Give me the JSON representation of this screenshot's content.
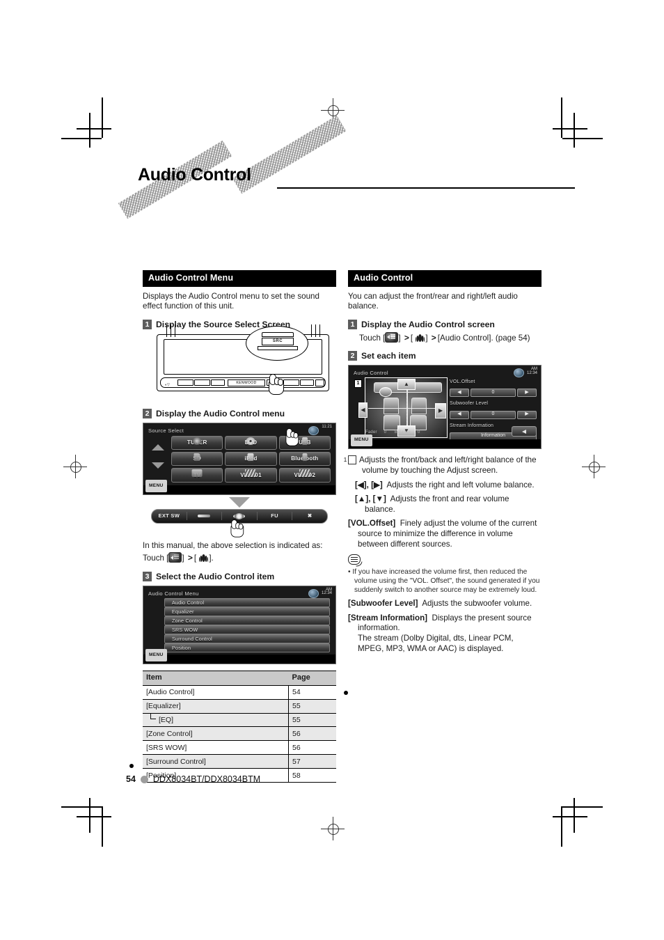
{
  "document": {
    "title": "Audio Control",
    "page_number": "54",
    "model": "DDX8034BT/DDX8034BTM"
  },
  "left_column": {
    "section_title": "Audio Control Menu",
    "intro": "Displays the Audio Control menu to set the sound effect function of this unit.",
    "step1": {
      "num": "1",
      "text": "Display the Source Select Screen"
    },
    "faceplate": {
      "button_label": "SRC",
      "brand": "KENWOOD"
    },
    "step2": {
      "num": "2",
      "text": "Display the Audio Control menu"
    },
    "source_select_screen": {
      "title": "Source Select",
      "clock": "11:21",
      "menu_button": "MENU",
      "sources": [
        "TUNER",
        "DVD",
        "USB",
        "SD",
        "iPod",
        "Bluetooth",
        "TV",
        "VIDEO1",
        "VIDEO2"
      ]
    },
    "bottom_strip": [
      "EXT SW",
      "setup-icon",
      "audio-icon",
      "FU",
      "close-icon"
    ],
    "manual_note_line1": "In this manual, the above selection is indicated as:",
    "manual_note_touch_prefix": "Touch [",
    "manual_note_touch_mid": "] ",
    "manual_note_touch_sep": "> [ ",
    "manual_note_touch_suffix": "].",
    "step3": {
      "num": "3",
      "text": "Select the Audio Control item"
    },
    "audio_control_menu_screen": {
      "title": "Audio Control Menu",
      "clock_ampm": "AM",
      "clock_time": "12:34",
      "menu_button": "MENU",
      "rows": [
        "Audio Control",
        "Equalizer",
        "Zone Control",
        "SRS WOW",
        "Surround Control",
        "Position"
      ]
    },
    "table": {
      "headers": [
        "Item",
        "Page"
      ],
      "rows": [
        {
          "item": "[Audio Control]",
          "page": "54",
          "sub": false
        },
        {
          "item": "[Equalizer]",
          "page": "55",
          "sub": false
        },
        {
          "item": "[EQ]",
          "page": "55",
          "sub": true
        },
        {
          "item": "[Zone Control]",
          "page": "56",
          "sub": false
        },
        {
          "item": "[SRS WOW]",
          "page": "56",
          "sub": false
        },
        {
          "item": "[Surround Control]",
          "page": "57",
          "sub": false
        },
        {
          "item": "[Position]",
          "page": "58",
          "sub": false
        }
      ]
    }
  },
  "right_column": {
    "section_title": "Audio Control",
    "intro": "You can adjust the front/rear and right/left audio balance.",
    "step1": {
      "num": "1",
      "text": "Display the Audio Control screen"
    },
    "touch_prefix": "Touch [",
    "touch_sep1": "] ",
    "touch_sep2": "> [ ",
    "touch_sep3": "] ",
    "touch_tail": "> [Audio Control]. (page 54)",
    "step2": {
      "num": "2",
      "text": "Set each item"
    },
    "audio_control_screen": {
      "title": "Audio Control",
      "clock_ampm": "AM",
      "clock_time": "12:34",
      "menu_button": "MENU",
      "marker": "1",
      "vol_offset_label": "VOL.Offset",
      "vol_offset_value": "0",
      "subwoofer_label": "Subwoofer Level",
      "subwoofer_value": "0",
      "stream_label": "Stream Information",
      "stream_button": "Information",
      "fader_label": "Fader",
      "fader_value": "0",
      "balance_label": "Balance",
      "balance_value": "0"
    },
    "desc_marker": "1",
    "desc_1": "Adjusts the front/back and left/right balance of the volume by touching the Adjust screen.",
    "desc_lr_key": "[◀], [▶]",
    "desc_lr_text": "Adjusts the right and left volume balance.",
    "desc_ud_key": "[▲], [▼]",
    "desc_ud_text": "Adjusts the front and rear volume balance.",
    "vol_offset_key": "[VOL.Offset]",
    "vol_offset_text": "Finely adjust the volume of the current source to minimize the difference in volume between different sources.",
    "note_text": "If you have increased the volume first, then reduced the volume using the \"VOL. Offset\", the sound generated if you suddenly switch to another source may be extremely loud.",
    "subwoofer_key": "[Subwoofer Level]",
    "subwoofer_text": "Adjusts the subwoofer volume.",
    "stream_key": "[Stream Information]",
    "stream_text": "Displays the present source information.",
    "stream_text2": "The stream (Dolby Digital, dts, Linear PCM, MPEG, MP3, WMA or AAC) is displayed."
  }
}
